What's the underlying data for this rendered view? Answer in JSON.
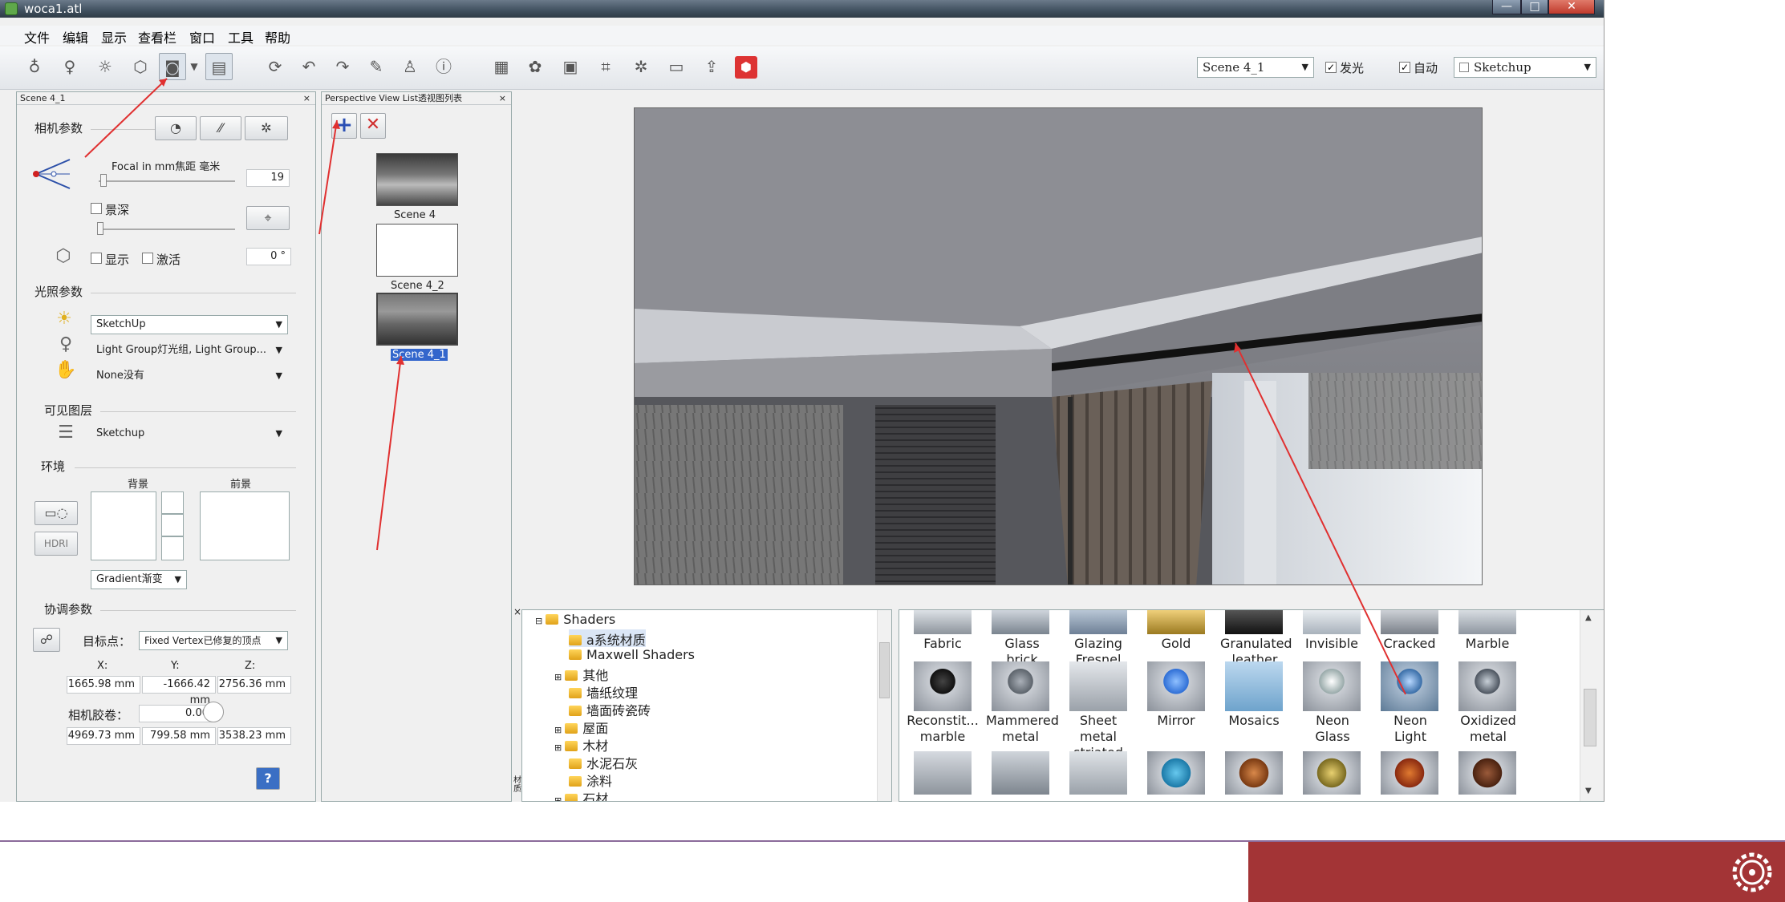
{
  "window": {
    "title": "woca1.atl"
  },
  "menu": [
    "文件",
    "编辑",
    "显示",
    "查看栏",
    "窗口",
    "工具",
    "帮助"
  ],
  "toolbar": {
    "scene_select": "Scene 4_1",
    "emit_label": "发光",
    "emit_checked": true,
    "auto_label": "自动",
    "auto_checked": true,
    "render_select": "Sketchup"
  },
  "camera_panel": {
    "header": "Scene 4_1",
    "camera_params": "相机参数",
    "focal_label": "Focal in mm焦距 毫米",
    "focal_value": "19",
    "dof_label": "景深",
    "show_label": "显示",
    "activate_label": "激活",
    "angle_value": "0 °",
    "light_params": "光照参数",
    "light_source": "SketchUp",
    "light_group": "Light Group灯光组, Light Group...",
    "light_none": "None没有",
    "visible_layers": "可见图层",
    "layer_select": "Sketchup",
    "env": "环境",
    "bg_label": "背景",
    "fg_label": "前景",
    "hdri": "HDRI",
    "gradient": "Gradient渐变",
    "coord_params": "协调参数",
    "target_label": "目标点：",
    "target_select": "Fixed Vertex已修复的顶点",
    "x_label": "X:",
    "y_label": "Y:",
    "z_label": "Z:",
    "target_x": "1665.98 mm",
    "target_y": "-1666.42 mm",
    "target_z": "2756.36 mm",
    "roll_label": "相机胶卷：",
    "roll_value": "0.00",
    "pos_x": "4969.73 mm",
    "pos_y": "799.58 mm",
    "pos_z": "3538.23 mm",
    "help": "?"
  },
  "view_list": {
    "header": "Perspective View List透视图列表",
    "add_icon": "plus-icon",
    "remove_icon": "cross-icon",
    "views": [
      "Scene 4",
      "Scene 4_2",
      "Scene 4_1"
    ],
    "selected": "Scene 4_1"
  },
  "shader_tree": {
    "side_label": "材质",
    "root": "Shaders",
    "items": [
      "a系统材质",
      "Maxwell Shaders",
      "其他",
      "墙纸纹理",
      "墙面砖瓷砖",
      "屋面",
      "木材",
      "水泥石灰",
      "涂料",
      "石材"
    ]
  },
  "shader_grid": {
    "row1": [
      "Fabric",
      "Glass brick",
      "Glazing Fresnel",
      "Gold",
      "Granulated leather",
      "Invisible",
      "Cracked",
      "Marble"
    ],
    "row2": [
      "Reconstit... marble",
      "Mammered metal",
      "Sheet metal striated",
      "Mirror",
      "Mosaics",
      "Neon Glass",
      "Neon Light",
      "Oxidized metal"
    ]
  },
  "colors": {
    "accent_red": "#a33436",
    "footer_line": "#8b6b9b",
    "annotation": "#e03030"
  }
}
